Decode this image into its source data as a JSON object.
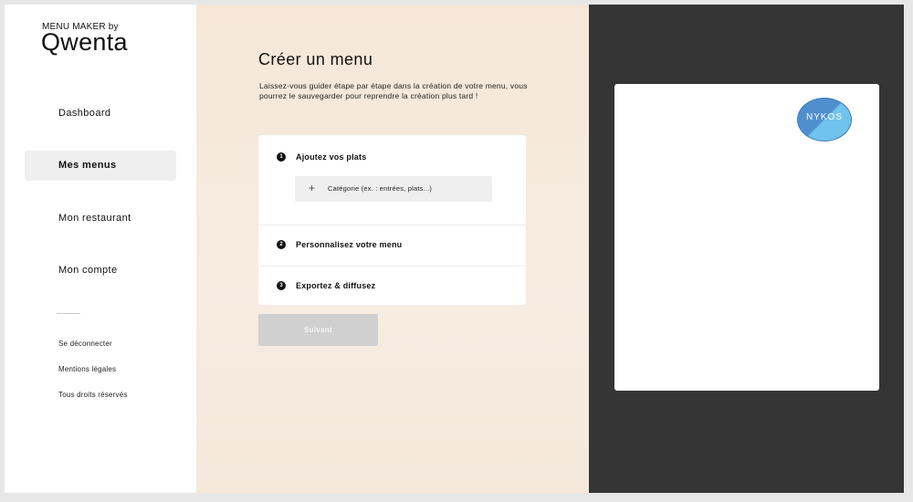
{
  "brand": {
    "top": "MENU MAKER by",
    "name": "Qwenta"
  },
  "sidebar": {
    "items": [
      {
        "label": "Dashboard"
      },
      {
        "label": "Mes menus"
      },
      {
        "label": "Mon restaurant"
      },
      {
        "label": "Mon compte"
      }
    ],
    "active": "Mes menus",
    "links": {
      "logout": "Se déconnecter",
      "legal": "Mentions légales",
      "rights": "Tous droits réservés"
    }
  },
  "main": {
    "title": "Créer un menu",
    "intro": "Laissez-vous guider étape par étape dans la création de votre menu, vous pourrez le sauvegarder pour reprendre la création plus tard !",
    "steps": [
      {
        "num": "1",
        "label": "Ajoutez vos plats"
      },
      {
        "num": "2",
        "label": "Personnalisez votre menu"
      },
      {
        "num": "3",
        "label": "Exportez & diffusez"
      }
    ],
    "category_button": {
      "icon": "plus-icon",
      "label": "Catégorie (ex. : entrées, plats...)"
    },
    "next_button": "Suivant"
  },
  "preview": {
    "logo_text": "NYKOS"
  },
  "colors": {
    "main_bg": "#f6e7d8",
    "preview_bg": "#353535",
    "active_nav_bg": "#efefef",
    "disabled_button": "#d0d0d0",
    "logo_blue": "#4f8fcf",
    "logo_light": "#6fc3ec"
  }
}
